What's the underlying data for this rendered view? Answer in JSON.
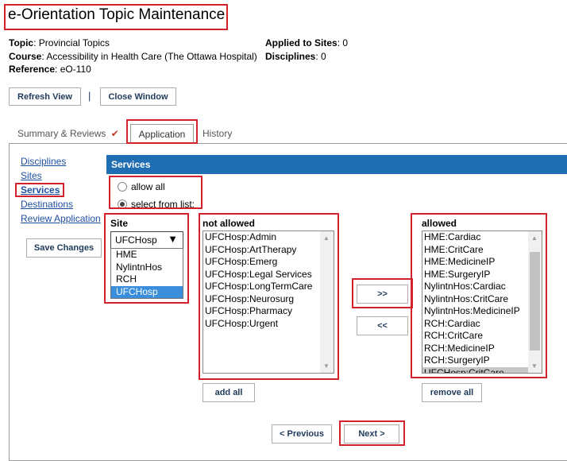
{
  "header": {
    "title": "e-Orientation Topic Maintenance",
    "topic_label": "Topic",
    "topic_value": ": Provincial Topics",
    "course_label": "Course",
    "course_value": ": Accessibility in Health Care (The Ottawa Hospital)",
    "reference_label": "Reference",
    "reference_value": ": eO-110",
    "applied_label": "Applied to Sites",
    "applied_value": ": 0",
    "disciplines_label": "Disciplines",
    "disciplines_value": ": 0"
  },
  "toolbar": {
    "refresh_label": "Refresh View",
    "separator": "|",
    "close_label": "Close Window"
  },
  "tabs": {
    "summary": "Summary & Reviews",
    "summary_check": "✔",
    "application": "Application",
    "history": "History"
  },
  "sidebar": {
    "items": [
      "Disciplines",
      "Sites",
      "Services",
      "Destinations",
      "Review Application"
    ],
    "save_label": "Save Changes"
  },
  "services": {
    "header": "Services",
    "allow_all": "allow all",
    "select_from_list": "select from list:",
    "site_label": "Site",
    "site_selected": "UFCHosp",
    "site_arrow": "▼",
    "site_options": [
      "HME",
      "NylintnHos",
      "RCH",
      "UFCHosp"
    ],
    "not_allowed_label": "not allowed",
    "not_allowed": [
      "UFCHosp:Admin",
      "UFCHosp:ArtTherapy",
      "UFCHosp:Emerg",
      "UFCHosp:Legal Services",
      "UFCHosp:LongTermCare",
      "UFCHosp:Neurosurg",
      "UFCHosp:Pharmacy",
      "UFCHosp:Urgent"
    ],
    "allowed_label": "allowed",
    "allowed": [
      "HME:Cardiac",
      "HME:CritCare",
      "HME:MedicineIP",
      "HME:SurgeryIP",
      "NylintnHos:Cardiac",
      "NylintnHos:CritCare",
      "NylintnHos:MedicineIP",
      "RCH:Cardiac",
      "RCH:CritCare",
      "RCH:MedicineIP",
      "RCH:SurgeryIP",
      "UFCHosp:CritCare"
    ],
    "move_right": ">>",
    "move_left": "<<",
    "add_all": "add all",
    "remove_all": "remove all"
  },
  "nav": {
    "previous": "< Previous",
    "next": "Next >"
  },
  "colors": {
    "accent_blue": "#1f6db3",
    "highlight_red": "#d3212d",
    "link_blue": "#1f4fa0",
    "check_red": "#c0392b"
  }
}
